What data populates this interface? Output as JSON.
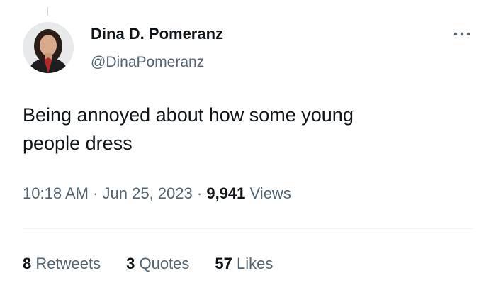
{
  "tweet": {
    "author": {
      "display_name": "Dina D. Pomeranz",
      "handle": "@DinaPomeranz"
    },
    "text": "Being annoyed about how some young\npeople dress",
    "time": "10:18 AM",
    "date": "Jun 25, 2023",
    "separator": "·",
    "views_count": "9,941",
    "views_label": "Views",
    "stats": [
      {
        "count": "8",
        "label": "Retweets"
      },
      {
        "count": "3",
        "label": "Quotes"
      },
      {
        "count": "57",
        "label": "Likes"
      }
    ],
    "more_icon": "more-horizontal-icon"
  },
  "colors": {
    "text_primary": "#0f1419",
    "text_secondary": "#536471",
    "divider": "#eff3f4"
  }
}
